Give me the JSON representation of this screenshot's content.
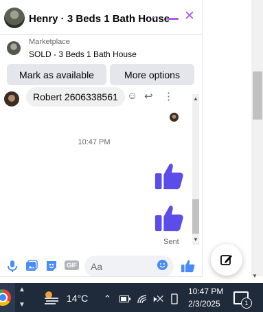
{
  "header": {
    "title": "Henry · 3 Beds 1 Bath House",
    "chevron": "⌄",
    "close": "✕"
  },
  "marketplace": {
    "label": "Marketplace",
    "listing": "SOLD - 3 Beds 1 Bath House"
  },
  "actions": {
    "mark_available": "Mark as available",
    "more_options": "More options"
  },
  "messages": {
    "incoming_text": "Robert 2606338561",
    "timestamp": "10:47 PM",
    "status": "Sent"
  },
  "composer": {
    "placeholder": "Aa",
    "gif_label": "GIF"
  },
  "colors": {
    "accent": "#a64ef2",
    "like": "#5b4de8",
    "taskbar": "#1f2a3a"
  },
  "taskbar": {
    "temperature": "14°C",
    "time": "10:47 PM",
    "date": "2/3/2025",
    "notification_count": "1"
  }
}
